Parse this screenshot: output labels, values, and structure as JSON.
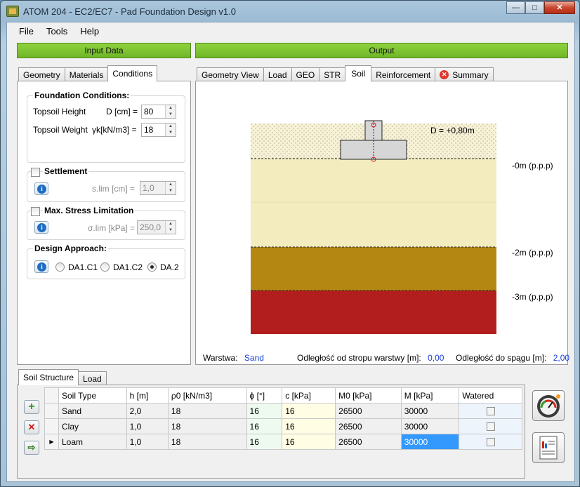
{
  "window": {
    "title": "ATOM 204 - EC2/EC7 - Pad Foundation Design v1.0",
    "minimize": "—",
    "maximize": "□",
    "close": "✕"
  },
  "menu": [
    "File",
    "Tools",
    "Help"
  ],
  "input_button": "Input Data",
  "output_button": "Output",
  "left_tabs": [
    "Geometry",
    "Materials",
    "Conditions"
  ],
  "foundation_conditions": {
    "title": "Foundation Conditions:",
    "topsoil_height": {
      "label": "Topsoil Height",
      "symbol": "D [cm] =",
      "value": "80"
    },
    "topsoil_weight": {
      "label": "Topsoil Weight",
      "symbol": "γk[kN/m3] =",
      "value": "18"
    }
  },
  "settlement": {
    "title": "Settlement",
    "symbol": "s.lim [cm] =",
    "value": "1,0"
  },
  "stress": {
    "title": "Max. Stress Limitation",
    "symbol": "σ.lim [kPa] =",
    "value": "250,0"
  },
  "design_approach": {
    "title": "Design Approach:",
    "options": [
      "DA1.C1",
      "DA1.C2",
      "DA.2"
    ],
    "selected": "DA.2"
  },
  "output_tabs": [
    "Geometry View",
    "Load",
    "GEO",
    "STR",
    "Soil",
    "Reinforcement",
    "Summary"
  ],
  "soil_view": {
    "depth_label": "D = +0,80m",
    "levels": [
      "-0m (p.p.p)",
      "-2m (p.p.p)",
      "-3m (p.p.p)"
    ],
    "layer_colors": [
      "#f2ecbf",
      "#b48712",
      "#b21e1e"
    ]
  },
  "status": {
    "layer_label": "Warstwa:",
    "layer_value": "Sand",
    "top_label": "Odległość od stropu warstwy [m]:",
    "top_value": "0,00",
    "bottom_label": "Odległość do spągu [m]:",
    "bottom_value": "2,00"
  },
  "bottom_tabs": [
    "Soil Structure",
    "Load"
  ],
  "table": {
    "headers": [
      "Soil Type",
      "h [m]",
      "ρ0 [kN/m3]",
      "ϕ [°]",
      "c [kPa]",
      "M0 [kPa]",
      "M [kPa]",
      "Watered"
    ],
    "rows": [
      [
        "Sand",
        "2,0",
        "18",
        "16",
        "16",
        "26500",
        "30000"
      ],
      [
        "Clay",
        "1,0",
        "18",
        "16",
        "16",
        "26500",
        "30000"
      ],
      [
        "Loam",
        "1,0",
        "18",
        "16",
        "16",
        "26500",
        "30000"
      ]
    ]
  },
  "row_pointer": "▶",
  "side_buttons": {
    "add": "+",
    "remove": "✕",
    "export": "⇨"
  }
}
